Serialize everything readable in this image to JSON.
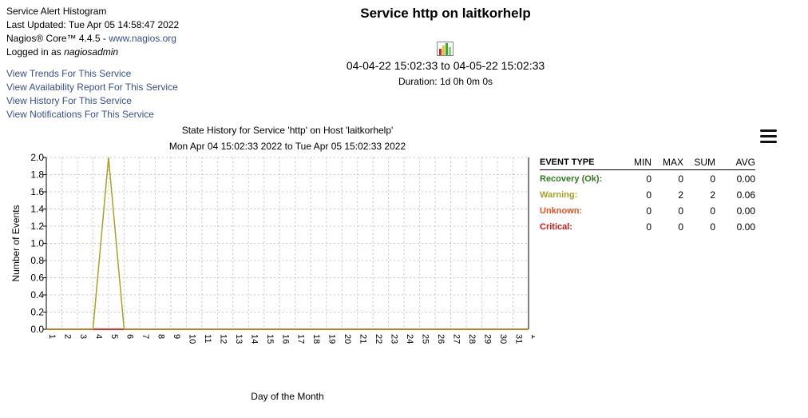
{
  "header": {
    "report_name": "Service Alert Histogram",
    "last_updated": "Last Updated: Tue Apr 05 14:58:47 2022",
    "product": "Nagios® Core™ 4.4.5 - ",
    "product_link": "www.nagios.org",
    "logged_in_prefix": "Logged in as ",
    "user": "nagiosadmin"
  },
  "links": [
    "View Trends For This Service",
    "View Availability Report For This Service",
    "View History For This Service",
    "View Notifications For This Service"
  ],
  "page_title": "Service http on laitkorhelp",
  "date_range": "04-04-22 15:02:33 to 04-05-22 15:02:33",
  "duration": "Duration: 1d 0h 0m 0s",
  "icons": {
    "report": "report-chart-icon",
    "menu": "hamburger-menu-icon"
  },
  "summary": {
    "headers": {
      "type": "EVENT TYPE",
      "min": "MIN",
      "max": "MAX",
      "sum": "SUM",
      "avg": "AVG"
    },
    "rows": [
      {
        "type": "Recovery (Ok):",
        "min": "0",
        "max": "0",
        "sum": "0",
        "avg": "0.00",
        "color": "#2f7a1e"
      },
      {
        "type": "Warning:",
        "min": "0",
        "max": "2",
        "sum": "2",
        "avg": "0.06",
        "color": "#a8a023"
      },
      {
        "type": "Unknown:",
        "min": "0",
        "max": "0",
        "sum": "0",
        "avg": "0.00",
        "color": "#f05020"
      },
      {
        "type": "Critical:",
        "min": "0",
        "max": "0",
        "sum": "0",
        "avg": "0.00",
        "color": "#e01010"
      }
    ]
  },
  "chart_data": {
    "type": "line",
    "title": "State History for Service 'http' on Host 'laitkorhelp'",
    "subtitle": "Mon Apr 04 15:02:33 2022 to Tue Apr 05 15:02:33 2022",
    "xlabel": "Day of the Month",
    "ylabel": "Number of Events",
    "categories": [
      "1",
      "2",
      "3",
      "4",
      "5",
      "6",
      "7",
      "8",
      "9",
      "10",
      "11",
      "12",
      "13",
      "14",
      "15",
      "16",
      "17",
      "18",
      "19",
      "20",
      "21",
      "22",
      "23",
      "24",
      "25",
      "26",
      "27",
      "28",
      "29",
      "30",
      "31",
      "1"
    ],
    "ylim": [
      0,
      2
    ],
    "yticks": [
      "0.0",
      "0.2",
      "0.4",
      "0.6",
      "0.8",
      "1.0",
      "1.2",
      "1.4",
      "1.6",
      "1.8",
      "2.0"
    ],
    "grid": true,
    "series": [
      {
        "name": "Recovery (Ok)",
        "color": "#2f7a1e",
        "values": [
          0,
          0,
          0,
          0,
          0,
          0,
          0,
          0,
          0,
          0,
          0,
          0,
          0,
          0,
          0,
          0,
          0,
          0,
          0,
          0,
          0,
          0,
          0,
          0,
          0,
          0,
          0,
          0,
          0,
          0,
          0,
          0
        ]
      },
      {
        "name": "Warning",
        "color": "#a8a023",
        "values": [
          0,
          0,
          0,
          0,
          2,
          0,
          0,
          0,
          0,
          0,
          0,
          0,
          0,
          0,
          0,
          0,
          0,
          0,
          0,
          0,
          0,
          0,
          0,
          0,
          0,
          0,
          0,
          0,
          0,
          0,
          0,
          0
        ]
      },
      {
        "name": "Unknown",
        "color": "#f05020",
        "values": [
          0,
          0,
          0,
          0,
          0,
          0,
          0,
          0,
          0,
          0,
          0,
          0,
          0,
          0,
          0,
          0,
          0,
          0,
          0,
          0,
          0,
          0,
          0,
          0,
          0,
          0,
          0,
          0,
          0,
          0,
          0,
          0
        ]
      },
      {
        "name": "Critical",
        "color": "#e01010",
        "values": [
          0,
          0,
          0,
          0,
          0,
          0,
          0,
          0,
          0,
          0,
          0,
          0,
          0,
          0,
          0,
          0,
          0,
          0,
          0,
          0,
          0,
          0,
          0,
          0,
          0,
          0,
          0,
          0,
          0,
          0,
          0,
          0
        ]
      }
    ]
  }
}
